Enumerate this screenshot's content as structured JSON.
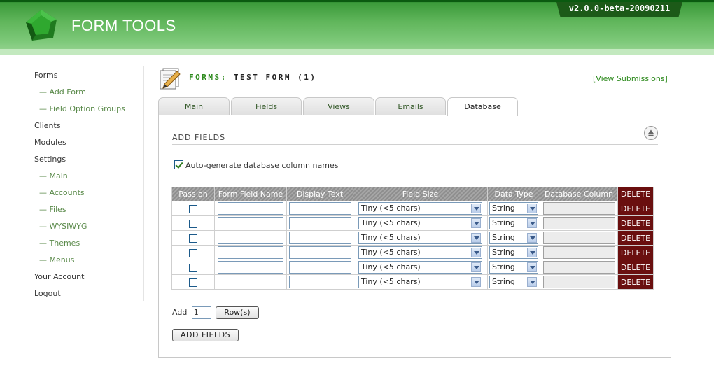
{
  "header": {
    "app_name": "FORM TOOLS",
    "version": "v2.0.0-beta-20090211",
    "brand_color": "#4fa84a"
  },
  "sidebar": {
    "items": [
      {
        "label": "Forms",
        "level": 0
      },
      {
        "label": "— Add Form",
        "level": 1
      },
      {
        "label": "— Field Option Groups",
        "level": 1
      },
      {
        "label": "Clients",
        "level": 0
      },
      {
        "label": "Modules",
        "level": 0
      },
      {
        "label": "Settings",
        "level": 0
      },
      {
        "label": "— Main",
        "level": 1
      },
      {
        "label": "— Accounts",
        "level": 1
      },
      {
        "label": "— Files",
        "level": 1
      },
      {
        "label": "— WYSIWYG",
        "level": 1
      },
      {
        "label": "— Themes",
        "level": 1
      },
      {
        "label": "— Menus",
        "level": 1
      },
      {
        "label": "Your Account",
        "level": 0
      },
      {
        "label": "Logout",
        "level": 0
      }
    ]
  },
  "page": {
    "title_prefix": "FORMS:",
    "title_main": "TEST FORM (1)",
    "view_submissions": "[View Submissions]"
  },
  "tabs": [
    {
      "label": "Main",
      "active": false
    },
    {
      "label": "Fields",
      "active": false
    },
    {
      "label": "Views",
      "active": false
    },
    {
      "label": "Emails",
      "active": false
    },
    {
      "label": "Database",
      "active": true
    }
  ],
  "section": {
    "title": "ADD FIELDS",
    "autogen_label": "Auto-generate database column names",
    "autogen_checked": true
  },
  "table": {
    "headers": [
      "Pass on",
      "Form Field Name",
      "Display Text",
      "Field Size",
      "Data Type",
      "Database Column",
      "DELETE"
    ],
    "rows": [
      {
        "pass_on": false,
        "field_name": "",
        "display_text": "",
        "field_size": "Tiny (<5 chars)",
        "data_type": "String",
        "db_column": "",
        "delete": "DELETE"
      },
      {
        "pass_on": false,
        "field_name": "",
        "display_text": "",
        "field_size": "Tiny (<5 chars)",
        "data_type": "String",
        "db_column": "",
        "delete": "DELETE"
      },
      {
        "pass_on": false,
        "field_name": "",
        "display_text": "",
        "field_size": "Tiny (<5 chars)",
        "data_type": "String",
        "db_column": "",
        "delete": "DELETE"
      },
      {
        "pass_on": false,
        "field_name": "",
        "display_text": "",
        "field_size": "Tiny (<5 chars)",
        "data_type": "String",
        "db_column": "",
        "delete": "DELETE"
      },
      {
        "pass_on": false,
        "field_name": "",
        "display_text": "",
        "field_size": "Tiny (<5 chars)",
        "data_type": "String",
        "db_column": "",
        "delete": "DELETE"
      },
      {
        "pass_on": false,
        "field_name": "",
        "display_text": "",
        "field_size": "Tiny (<5 chars)",
        "data_type": "String",
        "db_column": "",
        "delete": "DELETE"
      }
    ]
  },
  "add_rows": {
    "label": "Add",
    "quantity": "1",
    "button": "Row(s)"
  },
  "add_fields_button": "ADD FIELDS",
  "colors": {
    "delete_bg": "#6a0f0f",
    "link_green": "#2d8a1d"
  }
}
